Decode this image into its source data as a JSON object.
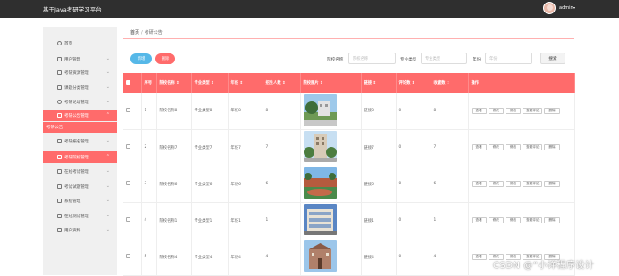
{
  "header": {
    "app_title": "基于Java考研学习平台",
    "user_name": "admin",
    "user_caret": "▾"
  },
  "sidebar": {
    "items": [
      {
        "label": "首页",
        "icon": "home-icon",
        "chevron": ""
      },
      {
        "label": "用户管理",
        "icon": "grid-icon",
        "chevron": "⌄"
      },
      {
        "label": "考研资源管理",
        "icon": "grid-icon",
        "chevron": "⌄"
      },
      {
        "label": "课题分类管理",
        "icon": "grid-icon",
        "chevron": "⌄"
      },
      {
        "label": "考研论坛管理",
        "icon": "user-icon",
        "chevron": "⌄"
      },
      {
        "label": "考研公告管理",
        "icon": "doc-icon",
        "chevron": "⌃"
      },
      {
        "label": "考研公告",
        "icon": "",
        "chevron": ""
      },
      {
        "label": "考研报名管理",
        "icon": "chat-icon",
        "chevron": "⌄"
      },
      {
        "label": "考研院校管理",
        "icon": "lock-icon",
        "chevron": "⌃"
      },
      {
        "label": "在线考试管理",
        "icon": "grid-icon",
        "chevron": "⌄"
      },
      {
        "label": "考试试题管理",
        "icon": "grid-icon",
        "chevron": "⌄"
      },
      {
        "label": "系统管理",
        "icon": "grid-icon",
        "chevron": "⌄"
      },
      {
        "label": "在线测试管理",
        "icon": "grid-icon",
        "chevron": "⌄"
      },
      {
        "label": "用户资料",
        "icon": "calendar-icon",
        "chevron": "⌄"
      }
    ]
  },
  "breadcrumb": {
    "home": "首页",
    "separator": "/",
    "current": "考研公告"
  },
  "filters": {
    "school_label": "院校名称",
    "school_placeholder": "院校名称",
    "type_label": "专业类型",
    "type_placeholder": "专业类型",
    "year_label": "年份",
    "year_placeholder": "年份",
    "search_button": "搜索"
  },
  "actions": {
    "add": "新增",
    "delete": "删除"
  },
  "table": {
    "headers": [
      "",
      "序号",
      "院校名称 ⇕",
      "专业类型 ⇕",
      "年份 ⇕",
      "招生人数 ⇕",
      "院校图片 ⇕",
      "链接 ⇕",
      "评论数 ⇕",
      "收藏数 ⇕",
      "操作"
    ],
    "op_labels": [
      "查看",
      "修改",
      "修改",
      "查看评论",
      "删除"
    ],
    "rows": [
      {
        "index": "1",
        "school": "院校名称8",
        "type": "专业类型8",
        "year": "年份8",
        "count": "8",
        "link": "链接8",
        "comments": "0",
        "favorites": "8"
      },
      {
        "index": "2",
        "school": "院校名称7",
        "type": "专业类型7",
        "year": "年份7",
        "count": "7",
        "link": "链接7",
        "comments": "0",
        "favorites": "7"
      },
      {
        "index": "3",
        "school": "院校名称6",
        "type": "专业类型6",
        "year": "年份6",
        "count": "6",
        "link": "链接6",
        "comments": "0",
        "favorites": "6"
      },
      {
        "index": "4",
        "school": "院校名称1",
        "type": "专业类型1",
        "year": "年份1",
        "count": "1",
        "link": "链接1",
        "comments": "0",
        "favorites": "1"
      },
      {
        "index": "5",
        "school": "院校名称4",
        "type": "专业类型4",
        "year": "年份4",
        "count": "4",
        "link": "链接4",
        "comments": "0",
        "favorites": "4"
      }
    ]
  },
  "watermark": "CSDN @“小详程序设计",
  "colors": {
    "accent": "#ff6b6b",
    "topbar": "#2f2f2f",
    "add_button": "#56b8e8"
  }
}
